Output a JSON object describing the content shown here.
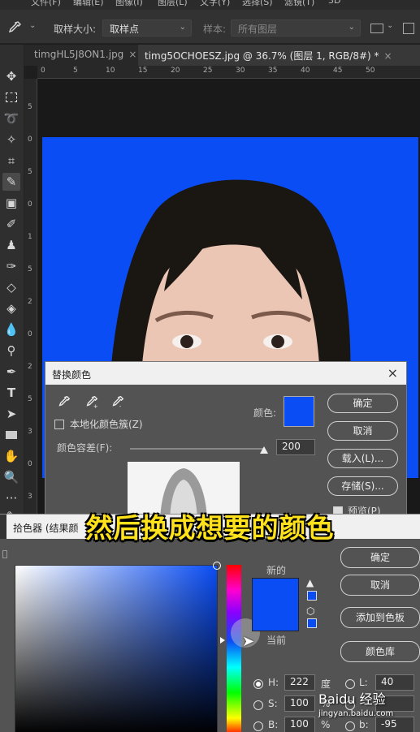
{
  "menubar": {
    "items": [
      "文件(F)",
      "编辑(E)",
      "图像(I)",
      "图层(L)",
      "文字(Y)",
      "选择(S)",
      "滤镜(T)",
      "3D"
    ]
  },
  "options": {
    "tool_icon": "eyedropper-icon",
    "sample_size_label": "取样大小:",
    "sample_size_value": "取样点",
    "sample_label": "样本:",
    "sample_value": "所有图层"
  },
  "tabs": [
    {
      "label": "timgHL5J8ON1.jpg",
      "close": "×"
    },
    {
      "label": "timg5OCHOESZ.jpg @ 36.7% (图层 1, RGB/8#) *",
      "close": "×"
    }
  ],
  "ruler": {
    "top_labels": [
      "0",
      "5",
      "10",
      "15",
      "20",
      "25",
      "30",
      "35",
      "40",
      "45",
      "50"
    ],
    "left_labels": [
      "5",
      "0",
      "5",
      "0",
      "1",
      "5",
      "2",
      "0",
      "2",
      "5",
      "3",
      "0",
      "3",
      "5",
      "4"
    ]
  },
  "replace_color": {
    "title": "替换颜色",
    "localized_label": "本地化颜色簇(Z)",
    "color_label": "颜色:",
    "tolerance_label": "颜色容差(F):",
    "tolerance_value": "200",
    "ok": "确定",
    "cancel": "取消",
    "load": "载入(L)...",
    "save": "存储(S)...",
    "preview": "预览(P)",
    "color": "#0a4df5"
  },
  "color_picker": {
    "title": "拾色器 (结果颜",
    "new_label": "新的",
    "current_label": "当前",
    "ok": "确定",
    "cancel": "取消",
    "add_swatches": "添加到色板",
    "color_libraries": "颜色库",
    "h_label": "H:",
    "h_value": "222",
    "h_unit": "度",
    "s_label": "S:",
    "s_value": "100",
    "s_unit": "%",
    "b_label": "B:",
    "b_value": "100",
    "b_unit": "%",
    "l_label": "L:",
    "l_value": "40",
    "bb_label": "b:",
    "bb_value": "-95",
    "color": "#0a4df5"
  },
  "subtitle": "然后换成想要的颜色",
  "watermark": {
    "main": "Baidu 经验",
    "sub": "jingyan.baidu.com"
  }
}
